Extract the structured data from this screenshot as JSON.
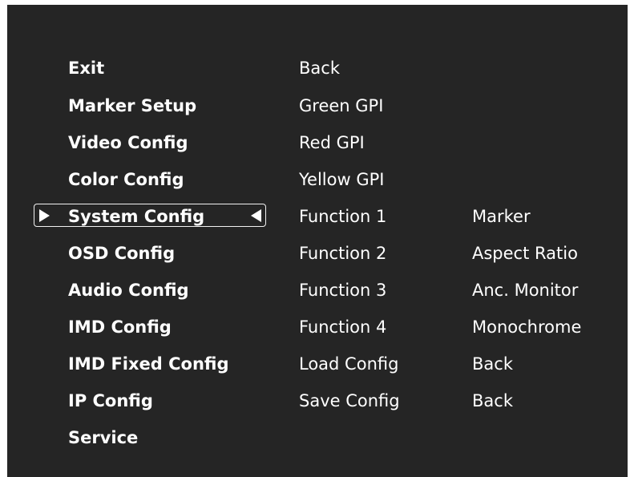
{
  "colors": {
    "page_background": "#ffffff",
    "osd_background": "#252525",
    "text": "#ffffff",
    "selection_border": "#f2f2f2"
  },
  "menu": {
    "items": [
      {
        "label": "Exit"
      },
      {
        "label": "Marker Setup"
      },
      {
        "label": "Video Config"
      },
      {
        "label": "Color Config"
      },
      {
        "label": "System Config",
        "selected": true
      },
      {
        "label": "OSD Config"
      },
      {
        "label": "Audio Config"
      },
      {
        "label": "IMD Config"
      },
      {
        "label": "IMD Fixed Config"
      },
      {
        "label": "IP Config"
      },
      {
        "label": "Service"
      }
    ],
    "selection_icons": [
      "arrow-right-icon",
      "arrow-left-icon"
    ]
  },
  "submenu": {
    "items": [
      {
        "label": "Back"
      },
      {
        "label": "Green GPI"
      },
      {
        "label": "Red GPI"
      },
      {
        "label": "Yellow GPI"
      },
      {
        "label": "Function 1",
        "value": "Marker"
      },
      {
        "label": "Function 2",
        "value": "Aspect Ratio"
      },
      {
        "label": "Function 3",
        "value": "Anc. Monitor"
      },
      {
        "label": "Function 4",
        "value": "Monochrome"
      },
      {
        "label": "Load Config",
        "value": "Back"
      },
      {
        "label": "Save Config",
        "value": "Back"
      }
    ]
  }
}
